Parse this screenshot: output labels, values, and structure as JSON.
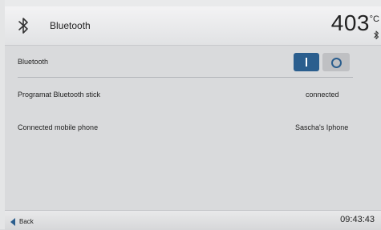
{
  "header": {
    "title": "Bluetooth",
    "icon": "bluetooth-icon",
    "temperature": "403",
    "temperature_unit": "°C",
    "status_icon": "bluetooth-status-icon"
  },
  "bluetooth_row": {
    "label": "Bluetooth",
    "toggle_on_symbol": "I",
    "toggle_off_symbol": "O",
    "state": "on",
    "on_color": "#2b5e8e",
    "off_color": "#bfc0c3"
  },
  "rows": [
    {
      "label": "Programat Bluetooth stick",
      "value": "connected"
    },
    {
      "label": "Connected mobile phone",
      "value": "Sascha's Iphone"
    }
  ],
  "footer": {
    "back_label": "Back",
    "time": "09:43:43"
  }
}
